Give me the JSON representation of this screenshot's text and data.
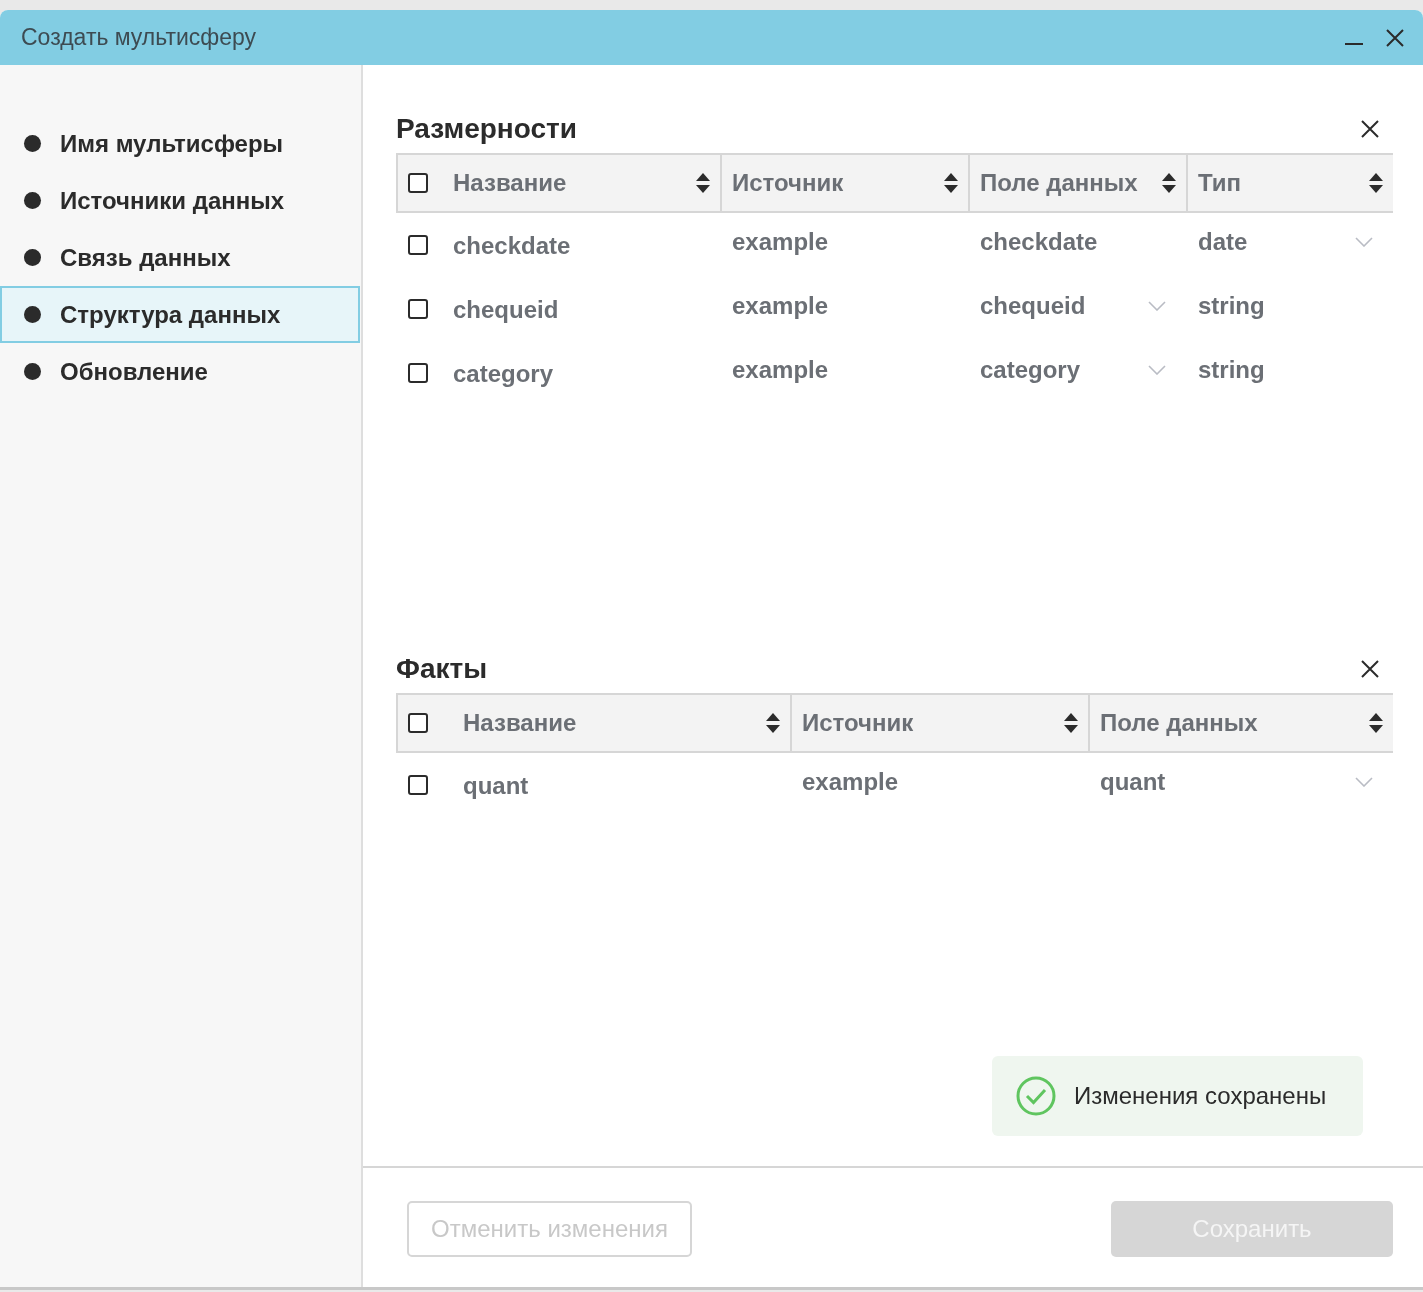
{
  "window": {
    "title": "Создать мультисферу"
  },
  "sidebar": {
    "items": [
      {
        "label": "Имя мультисферы",
        "selected": false
      },
      {
        "label": "Источники данных",
        "selected": false
      },
      {
        "label": "Связь данных",
        "selected": false
      },
      {
        "label": "Структура данных",
        "selected": true
      },
      {
        "label": "Обновление",
        "selected": false
      }
    ]
  },
  "sections": [
    {
      "title": "Размерности",
      "kind": "dims",
      "table": {
        "all_checked": false,
        "columns": [
          "Название",
          "Источник",
          "Поле данных",
          "Тип"
        ],
        "rows": [
          {
            "checked": false,
            "cells": [
              {
                "text": "checkdate"
              },
              {
                "text": "example"
              },
              {
                "text": "checkdate",
                "dropdown": false
              },
              {
                "text": "date",
                "dropdown": true
              }
            ]
          },
          {
            "checked": false,
            "cells": [
              {
                "text": "chequeid"
              },
              {
                "text": "example"
              },
              {
                "text": "chequeid",
                "dropdown": true
              },
              {
                "text": "string",
                "dropdown": false
              }
            ]
          },
          {
            "checked": false,
            "cells": [
              {
                "text": "category"
              },
              {
                "text": "example"
              },
              {
                "text": "category",
                "dropdown": true
              },
              {
                "text": "string",
                "dropdown": false
              }
            ]
          }
        ]
      }
    },
    {
      "title": "Факты",
      "kind": "facts",
      "table": {
        "all_checked": false,
        "columns": [
          "Название",
          "Источник",
          "Поле данных"
        ],
        "rows": [
          {
            "checked": false,
            "cells": [
              {
                "text": "quant"
              },
              {
                "text": "example"
              },
              {
                "text": "quant",
                "dropdown": true
              }
            ]
          }
        ]
      }
    }
  ],
  "toast": {
    "text": "Изменения сохранены"
  },
  "footer": {
    "buttons": [
      {
        "label": "Отменить изменения",
        "kind": "secondary",
        "disabled": true
      },
      {
        "label": "Сохранить",
        "kind": "primary",
        "disabled": true
      }
    ]
  }
}
